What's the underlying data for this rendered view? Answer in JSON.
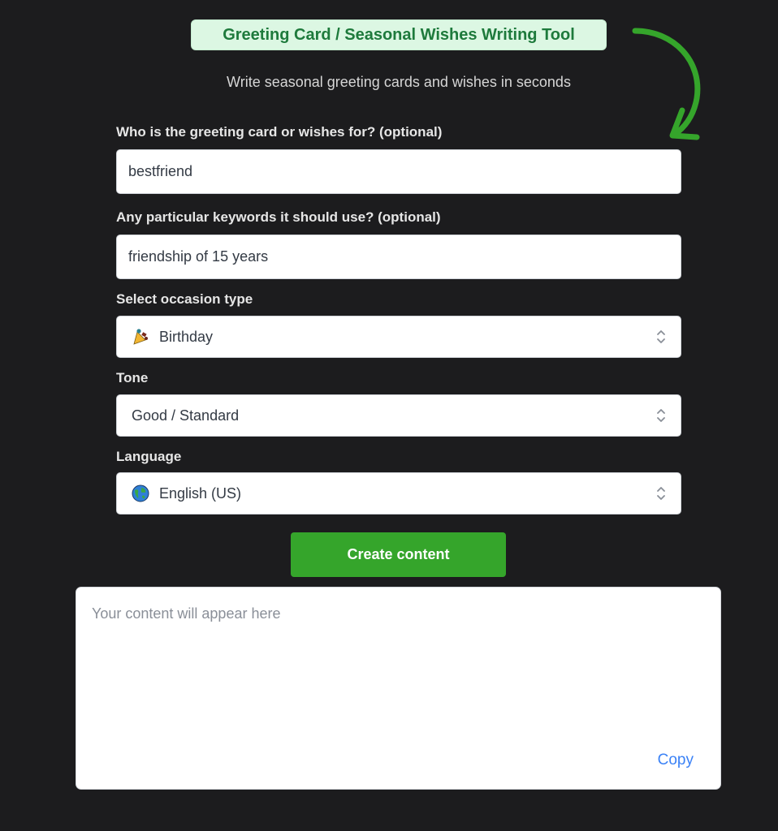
{
  "header": {
    "title": "Greeting Card / Seasonal Wishes Writing Tool",
    "subtitle": "Write seasonal greeting cards and wishes in seconds"
  },
  "form": {
    "recipient": {
      "label": "Who is the greeting card or wishes for? (optional)",
      "value": "bestfriend"
    },
    "keywords": {
      "label": "Any particular keywords it should use? (optional)",
      "value": "friendship of 15 years"
    },
    "occasion": {
      "label": "Select occasion type",
      "selected": "Birthday",
      "icon": "party-popper-icon"
    },
    "tone": {
      "label": "Tone",
      "selected": "Good / Standard"
    },
    "language": {
      "label": "Language",
      "selected": "English (US)",
      "icon": "globe-icon"
    },
    "submit_label": "Create content"
  },
  "output": {
    "placeholder": "Your content will appear here",
    "copy_label": "Copy"
  },
  "colors": {
    "accent_green": "#35a52b",
    "title_bg": "#dcf7e3",
    "title_text": "#1e7a3c",
    "link_blue": "#3b82f6",
    "page_bg": "#1c1c1e"
  }
}
